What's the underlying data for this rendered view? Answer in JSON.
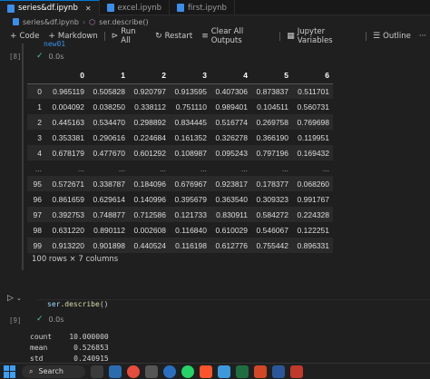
{
  "tabs": [
    {
      "label": "series&df.ipynb",
      "active": true
    },
    {
      "label": "excel.ipynb",
      "active": false
    },
    {
      "label": "first.ipynb",
      "active": false
    }
  ],
  "breadcrumb": {
    "file": "series&df.ipynb",
    "symbol": "ser.describe()"
  },
  "toolbar": {
    "code_label": "Code",
    "markdown_label": "Markdown",
    "run_all_label": "Run All",
    "restart_label": "Restart",
    "clear_outputs_label": "Clear All Outputs",
    "variables_label": "Jupyter Variables",
    "outline_label": "Outline",
    "more_label": "···"
  },
  "cell1": {
    "exec_count": "[8]",
    "title_cut": "new01",
    "duration": "0.0s",
    "shape_text": "100 rows × 7 columns"
  },
  "df": {
    "columns": [
      "0",
      "1",
      "2",
      "3",
      "4",
      "5",
      "6"
    ],
    "rows": [
      {
        "index": "0",
        "values": [
          "0.965119",
          "0.505828",
          "0.920797",
          "0.913595",
          "0.407306",
          "0.873837",
          "0.511701"
        ]
      },
      {
        "index": "1",
        "values": [
          "0.004092",
          "0.038250",
          "0.338112",
          "0.751110",
          "0.989401",
          "0.104511",
          "0.560731"
        ]
      },
      {
        "index": "2",
        "values": [
          "0.445163",
          "0.534470",
          "0.298892",
          "0.834445",
          "0.516774",
          "0.269758",
          "0.769698"
        ]
      },
      {
        "index": "3",
        "values": [
          "0.353381",
          "0.290616",
          "0.224684",
          "0.161352",
          "0.326278",
          "0.366190",
          "0.119951"
        ]
      },
      {
        "index": "4",
        "values": [
          "0.678179",
          "0.477670",
          "0.601292",
          "0.108987",
          "0.095243",
          "0.797196",
          "0.169432"
        ]
      },
      {
        "index": "...",
        "values": [
          "...",
          "...",
          "...",
          "...",
          "...",
          "...",
          "..."
        ]
      },
      {
        "index": "95",
        "values": [
          "0.572671",
          "0.338787",
          "0.184096",
          "0.676967",
          "0.923817",
          "0.178377",
          "0.068260"
        ]
      },
      {
        "index": "96",
        "values": [
          "0.861659",
          "0.629614",
          "0.140996",
          "0.395679",
          "0.363540",
          "0.309323",
          "0.991767"
        ]
      },
      {
        "index": "97",
        "values": [
          "0.392753",
          "0.748877",
          "0.712586",
          "0.121733",
          "0.830911",
          "0.584272",
          "0.224328"
        ]
      },
      {
        "index": "98",
        "values": [
          "0.631220",
          "0.890112",
          "0.002608",
          "0.116840",
          "0.610029",
          "0.546067",
          "0.122251"
        ]
      },
      {
        "index": "99",
        "values": [
          "0.913220",
          "0.901898",
          "0.440524",
          "0.116198",
          "0.612776",
          "0.755442",
          "0.896331"
        ]
      }
    ]
  },
  "cell2": {
    "code_var": "ser",
    "code_fn": ".describe",
    "code_punc": "()",
    "exec_count": "[9]",
    "duration": "0.0s",
    "output": "count    10.000000\nmean      0.526853\nstd       0.240915"
  },
  "taskbar": {
    "search_label": "Search"
  },
  "colors": {
    "accent": "#0078d4",
    "success": "#4ec9b0",
    "notebook_icon": "#3b8eea"
  }
}
